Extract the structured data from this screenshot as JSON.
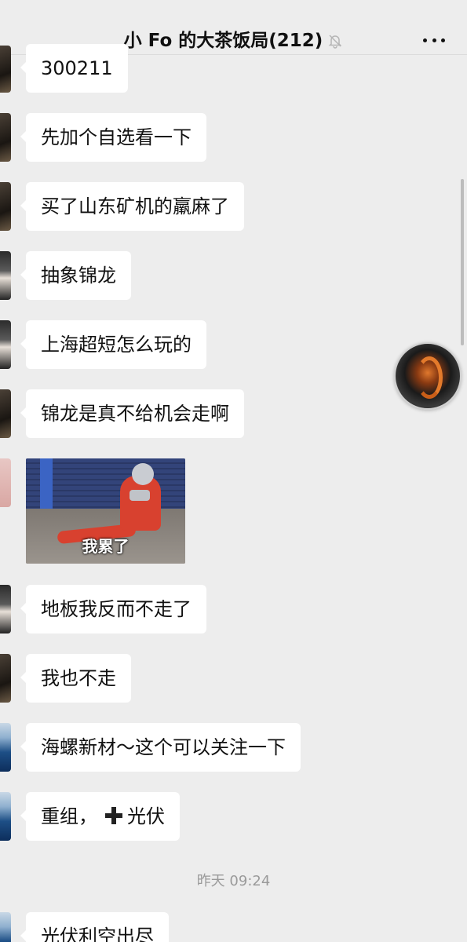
{
  "header": {
    "title": "小 Fo 的大茶饭局(212)",
    "muted_icon": "bell-off-icon",
    "more_icon": "more-dots-icon"
  },
  "messages": [
    {
      "text": "300211",
      "avatar": "dark-avatar"
    },
    {
      "text": "先加个自选看一下",
      "avatar": "dark-avatar"
    },
    {
      "text": "买了山东矿机的羸麻了",
      "avatar": "dark-avatar"
    },
    {
      "text": "抽象锦龙",
      "avatar": "anime-avatar"
    },
    {
      "text": "上海超短怎么玩的",
      "avatar": "anime-avatar"
    },
    {
      "text": "锦龙是真不给机会走啊",
      "avatar": "dark-avatar"
    },
    {
      "image_caption": "我累了",
      "avatar": "pink-avatar"
    },
    {
      "text": "地板我反而不走了",
      "avatar": "anime-avatar"
    },
    {
      "text": "我也不走",
      "avatar": "dark-avatar"
    },
    {
      "text": "海螺新材～这个可以关注一下",
      "avatar": "sea-avatar"
    },
    {
      "text_before": "重组，",
      "icon": "plus-icon",
      "text_after": "光伏",
      "avatar": "sea-avatar"
    },
    {
      "text": "光伏利空出尽",
      "avatar": "sea-avatar"
    }
  ],
  "timestamp": "昨天 09:24",
  "floating_avatar": "orange-swirl-avatar"
}
